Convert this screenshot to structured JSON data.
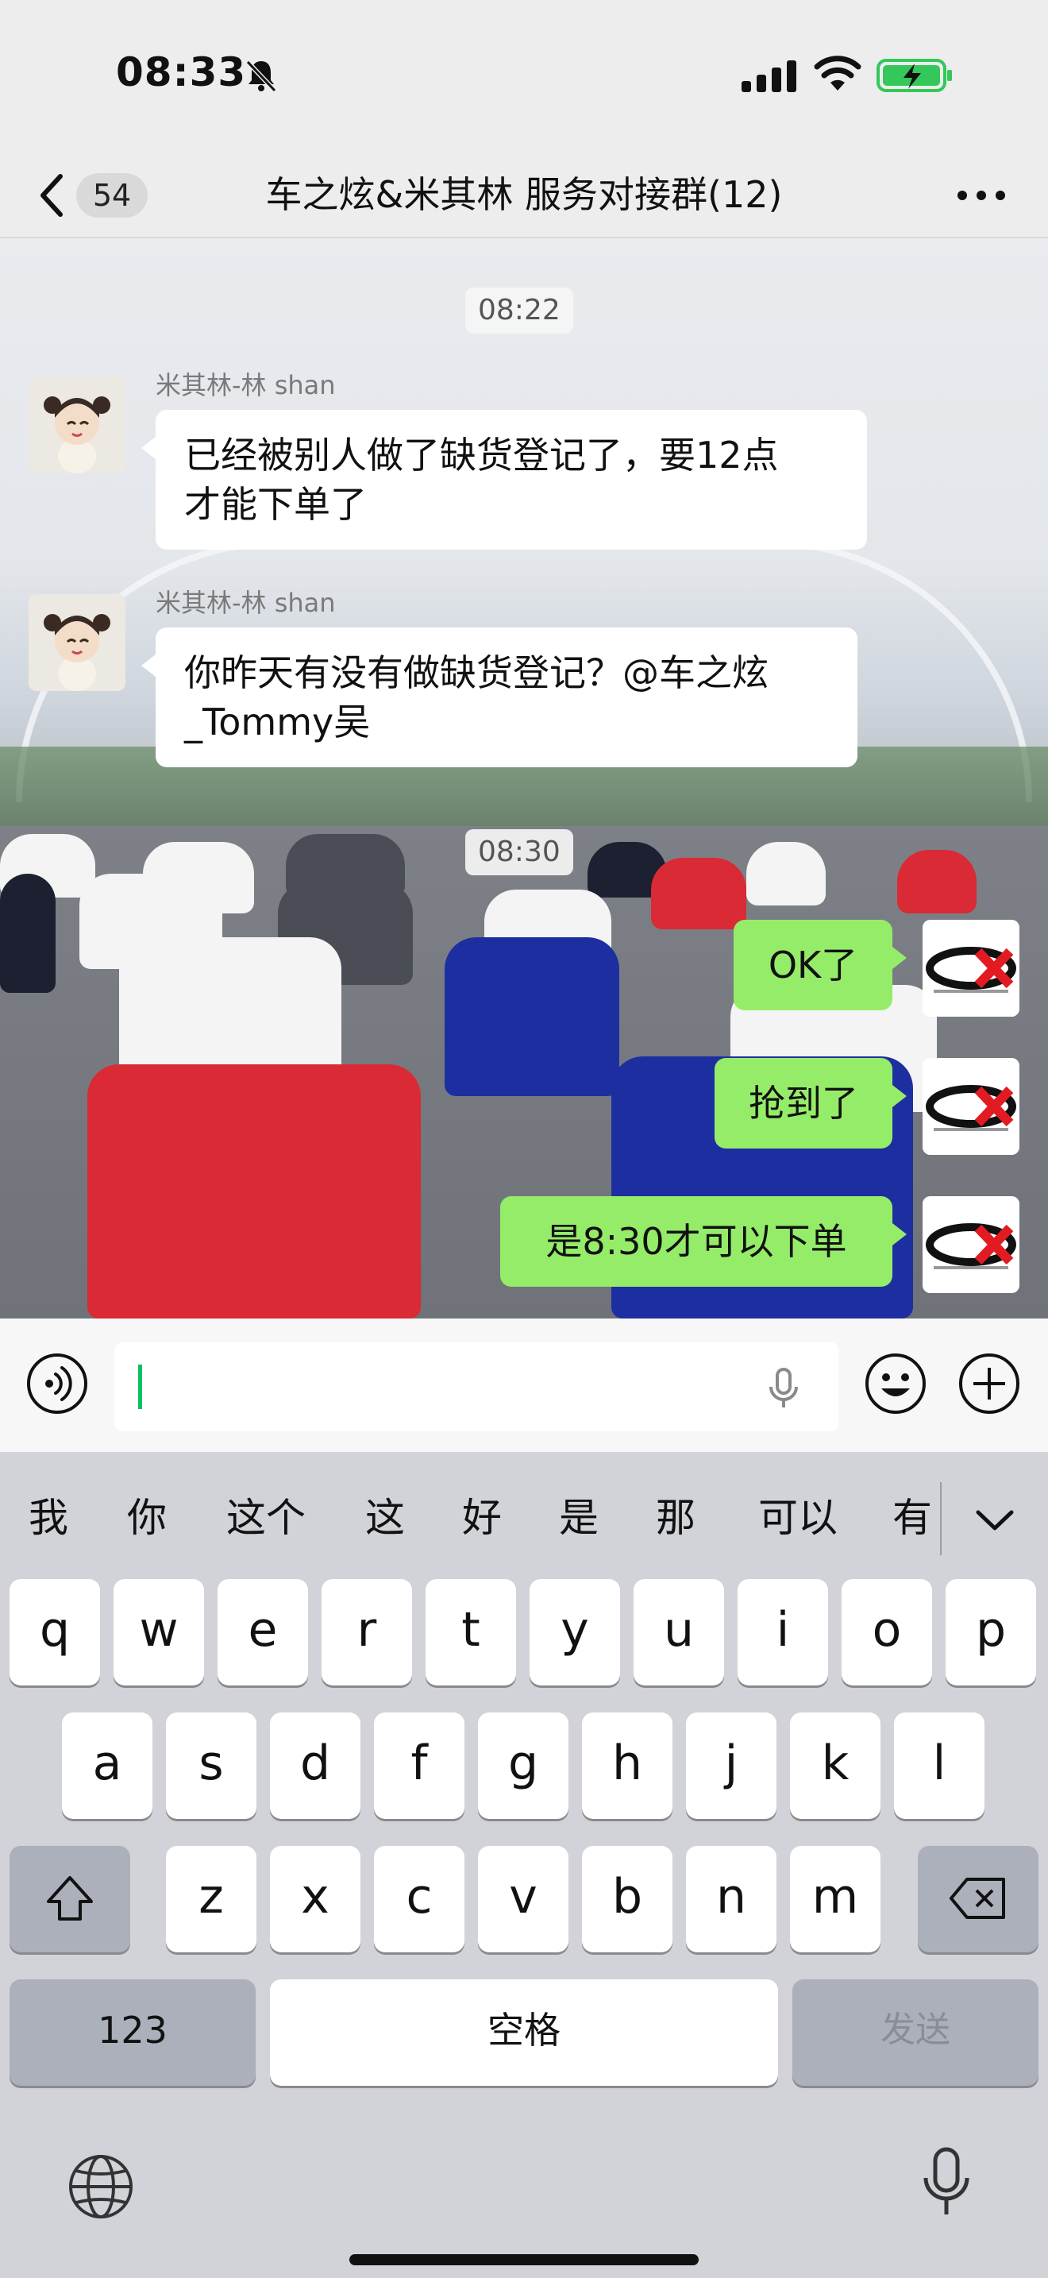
{
  "status_bar": {
    "time": "08:33"
  },
  "nav": {
    "unread_count": "54",
    "title": "车之炫&米其林 服务对接群(12)"
  },
  "chat": {
    "messages": [
      {
        "kind": "time",
        "text": "08:22"
      },
      {
        "kind": "incoming",
        "sender": "米其林-林 shan",
        "text": "已经被别人做了缺货登记了，要12点才能下单了"
      },
      {
        "kind": "incoming",
        "sender": "米其林-林 shan",
        "text": "你昨天有没有做缺货登记？@车之炫_Tommy吴"
      },
      {
        "kind": "time",
        "text": "08:30"
      },
      {
        "kind": "outgoing",
        "text": "OK了"
      },
      {
        "kind": "outgoing",
        "text": "抢到了"
      },
      {
        "kind": "outgoing",
        "text": "是8:30才可以下单"
      }
    ],
    "incoming_lines": [
      [
        "已经被别人做了缺货登记了，要12点",
        "才能下单了"
      ],
      [
        "你昨天有没有做缺货登记？@车之炫",
        "_Tommy吴"
      ]
    ]
  },
  "input": {
    "value": ""
  },
  "keyboard": {
    "suggestions": [
      "我",
      "你",
      "这个",
      "这",
      "好",
      "是",
      "那",
      "可以",
      "有"
    ],
    "row1": [
      "q",
      "w",
      "e",
      "r",
      "t",
      "y",
      "u",
      "i",
      "o",
      "p"
    ],
    "row2": [
      "a",
      "s",
      "d",
      "f",
      "g",
      "h",
      "j",
      "k",
      "l"
    ],
    "row3": [
      "z",
      "x",
      "c",
      "v",
      "b",
      "n",
      "m"
    ],
    "numbers_label": "123",
    "space_label": "空格",
    "send_label": "发送"
  },
  "colors": {
    "outgoing_bubble": "#95ec69",
    "incoming_bubble": "#ffffff",
    "accent": "#07c160",
    "battery": "#34c759"
  },
  "icons": [
    "bell-slash-icon",
    "signal-icon",
    "wifi-icon",
    "battery-charging-icon",
    "back-chevron-icon",
    "more-icon",
    "voice-icon",
    "mic-icon",
    "emoji-icon",
    "plus-icon",
    "shift-icon",
    "delete-icon",
    "globe-icon",
    "dictation-icon",
    "collapse-chevron-icon"
  ]
}
